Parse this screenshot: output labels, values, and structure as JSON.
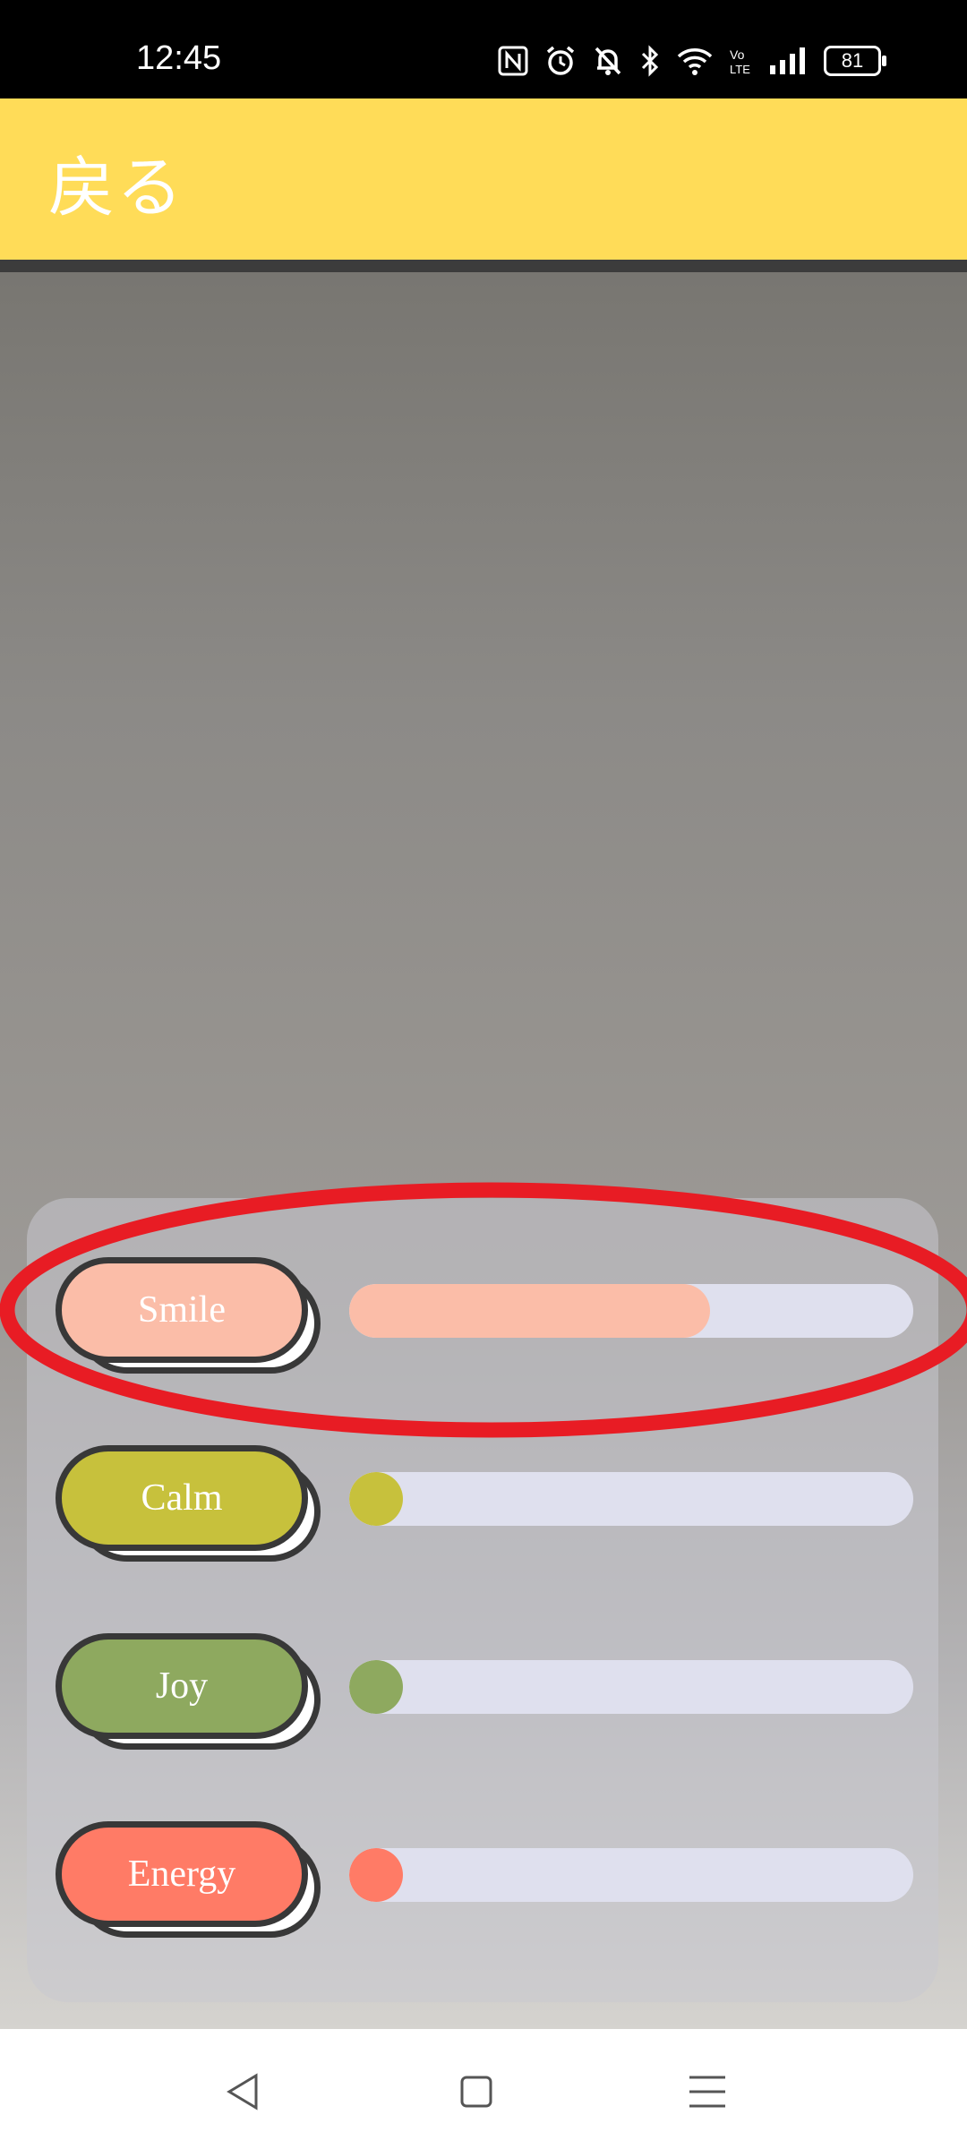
{
  "status_bar": {
    "time": "12:45",
    "battery": "81",
    "icons": [
      "nfc-icon",
      "alarm-icon",
      "mute-icon",
      "bluetooth-icon",
      "wifi-icon",
      "volte-icon",
      "signal-icon",
      "battery-icon"
    ]
  },
  "header": {
    "back_label": "戻る",
    "background": "#ffdc58"
  },
  "emotions": [
    {
      "label": "Smile",
      "color": "#fbbda8",
      "level": 0.64
    },
    {
      "label": "Calm",
      "color": "#c7c13c",
      "level": 0.0
    },
    {
      "label": "Joy",
      "color": "#8ea95f",
      "level": 0.0
    },
    {
      "label": "Energy",
      "color": "#ff7b66",
      "level": 0.0
    }
  ],
  "nav": {
    "icons": [
      "back-triangle-icon",
      "home-square-icon",
      "menu-lines-icon"
    ]
  },
  "annotation_color": "#e81c24"
}
